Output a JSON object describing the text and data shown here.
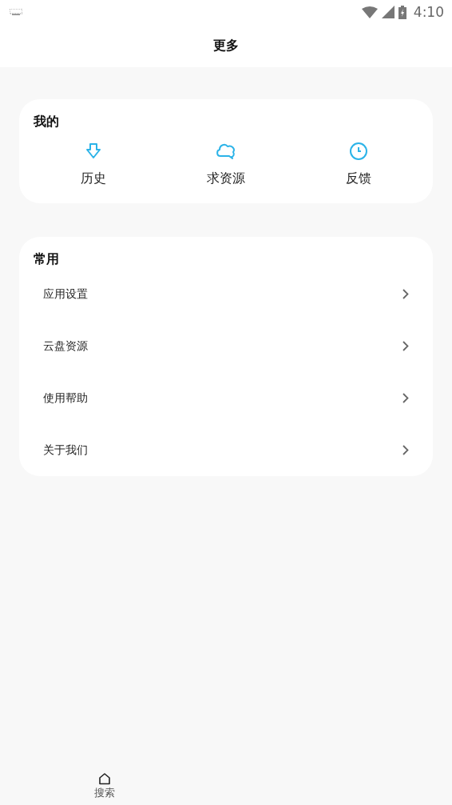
{
  "status_bar": {
    "time": "4:10"
  },
  "header": {
    "title": "更多"
  },
  "mine": {
    "title": "我的",
    "items": [
      {
        "label": "历史",
        "kind": "download"
      },
      {
        "label": "求资源",
        "kind": "cloud"
      },
      {
        "label": "反馈",
        "kind": "clock"
      }
    ]
  },
  "common": {
    "title": "常用",
    "items": [
      {
        "label": "应用设置"
      },
      {
        "label": "云盘资源"
      },
      {
        "label": "使用帮助"
      },
      {
        "label": "关于我们"
      }
    ]
  },
  "bottom_nav": [
    {
      "label": "搜索"
    }
  ]
}
